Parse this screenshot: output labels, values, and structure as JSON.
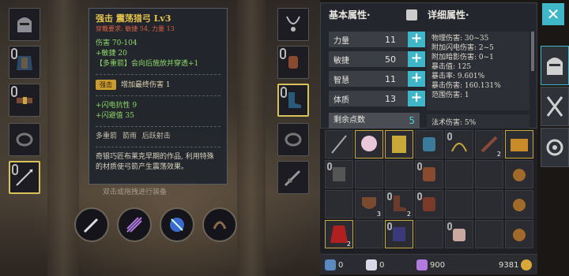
{
  "tooltip": {
    "title": "强击 震荡猎弓 Lv3",
    "requirement": "穿戴要求:  敏捷 54, 力量 13",
    "damage": "伤害  70-104",
    "agility": "+敏捷 20",
    "multishot": "【多重箭】会向后施放并穿透+1",
    "gem_badge": "强击",
    "gem_text": "增加最终伤害 1",
    "lightning_res": "+闪电抗性  9",
    "dodge": "+闪避值  35",
    "tags": "多重箭   箭雨   后跃射击",
    "description": "奇银巧匠布莱克早期的作品, 利用特殊的材质使弓箭产生震荡效果。"
  },
  "hint": "双击或拖拽进行装备",
  "stats_panel": {
    "base_header": "基本属性·",
    "detail_header": "详细属性·",
    "attributes": [
      {
        "label": "力量",
        "value": "11"
      },
      {
        "label": "敏捷",
        "value": "50"
      },
      {
        "label": "智慧",
        "value": "11"
      },
      {
        "label": "体质",
        "value": "13"
      }
    ],
    "remaining_label": "剩余点数",
    "remaining_value": "5",
    "details": [
      "物理伤害: 30~35",
      "附加闪电伤害: 2~5",
      "附加暗影伤害: 0~1",
      "暴击值: 125",
      "暴击率: 9.601%",
      "暴击伤害: 160.131%",
      "范围伤害: 1"
    ],
    "magic_damage": "法术伤害: 5%"
  },
  "inventory": {
    "counts": [
      "2",
      "3",
      "2",
      "2"
    ]
  },
  "currency": {
    "arrows": "0",
    "runes": "0",
    "crystals": "900",
    "gold": "9381"
  },
  "side_menu": {
    "close": "✕"
  }
}
